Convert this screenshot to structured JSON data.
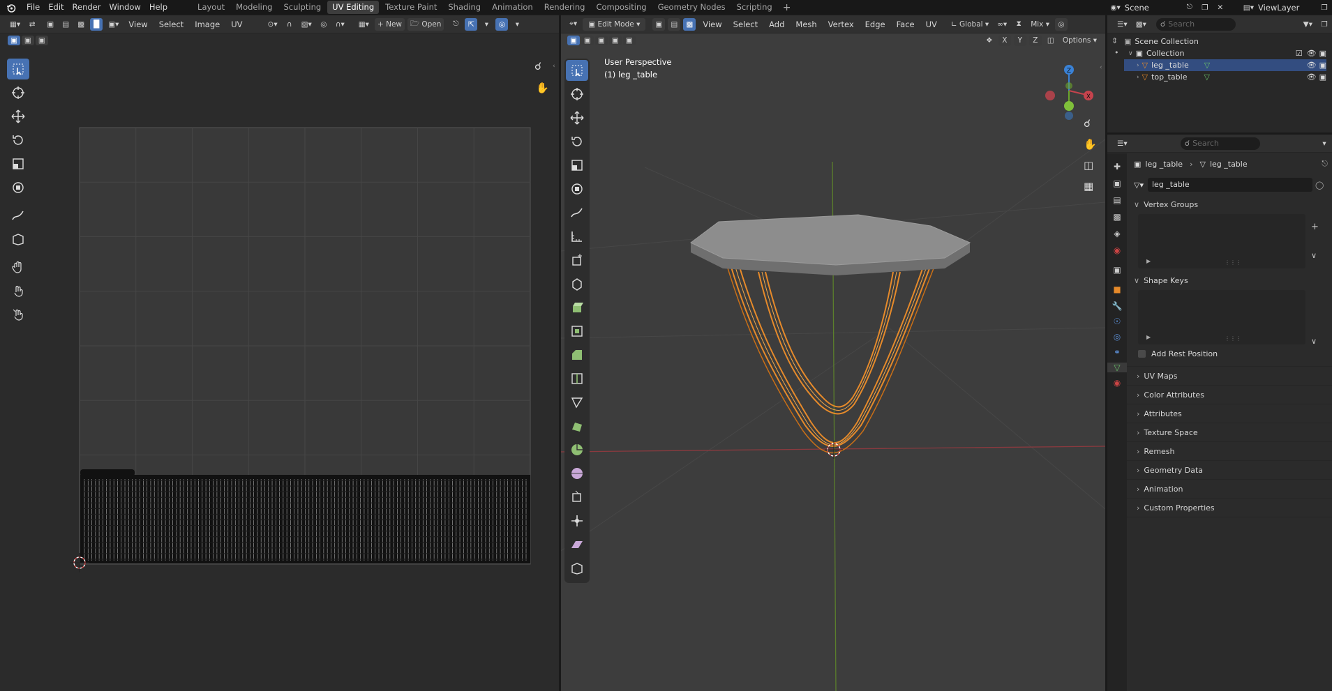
{
  "app": {
    "menus": [
      "File",
      "Edit",
      "Render",
      "Window",
      "Help"
    ],
    "workspaces": [
      "Layout",
      "Modeling",
      "Sculpting",
      "UV Editing",
      "Texture Paint",
      "Shading",
      "Animation",
      "Rendering",
      "Compositing",
      "Geometry Nodes",
      "Scripting"
    ],
    "active_workspace": "UV Editing",
    "scene": "Scene",
    "view_layer": "ViewLayer"
  },
  "uv_editor": {
    "menus": [
      "View",
      "Select",
      "Image",
      "UV"
    ],
    "new_label": "New",
    "open_label": "Open"
  },
  "viewport": {
    "mode": "Edit Mode",
    "menus": [
      "View",
      "Select",
      "Add",
      "Mesh",
      "Vertex",
      "Edge",
      "Face",
      "UV"
    ],
    "orientation": "Global",
    "pivot": "Mix",
    "options_label": "Options",
    "overlay_line1": "User Perspective",
    "overlay_line2": "(1) leg _table",
    "axes": [
      "X",
      "Y",
      "Z"
    ],
    "colors": {
      "x": "#c6434d",
      "y": "#6ca62c",
      "z": "#3a82d6",
      "selection": "#e68a2a"
    }
  },
  "outliner": {
    "search_placeholder": "Search",
    "scene_collection": "Scene Collection",
    "collection": "Collection",
    "objects": [
      "leg _table",
      "top_table"
    ]
  },
  "properties": {
    "search_placeholder": "Search",
    "breadcrumb_object": "leg _table",
    "breadcrumb_mesh": "leg _table",
    "mesh_name": "leg _table",
    "vertex_groups": "Vertex Groups",
    "shape_keys": "Shape Keys",
    "add_rest_position": "Add Rest Position",
    "sections": [
      "UV Maps",
      "Color Attributes",
      "Attributes",
      "Texture Space",
      "Remesh",
      "Geometry Data",
      "Animation",
      "Custom Properties"
    ]
  }
}
